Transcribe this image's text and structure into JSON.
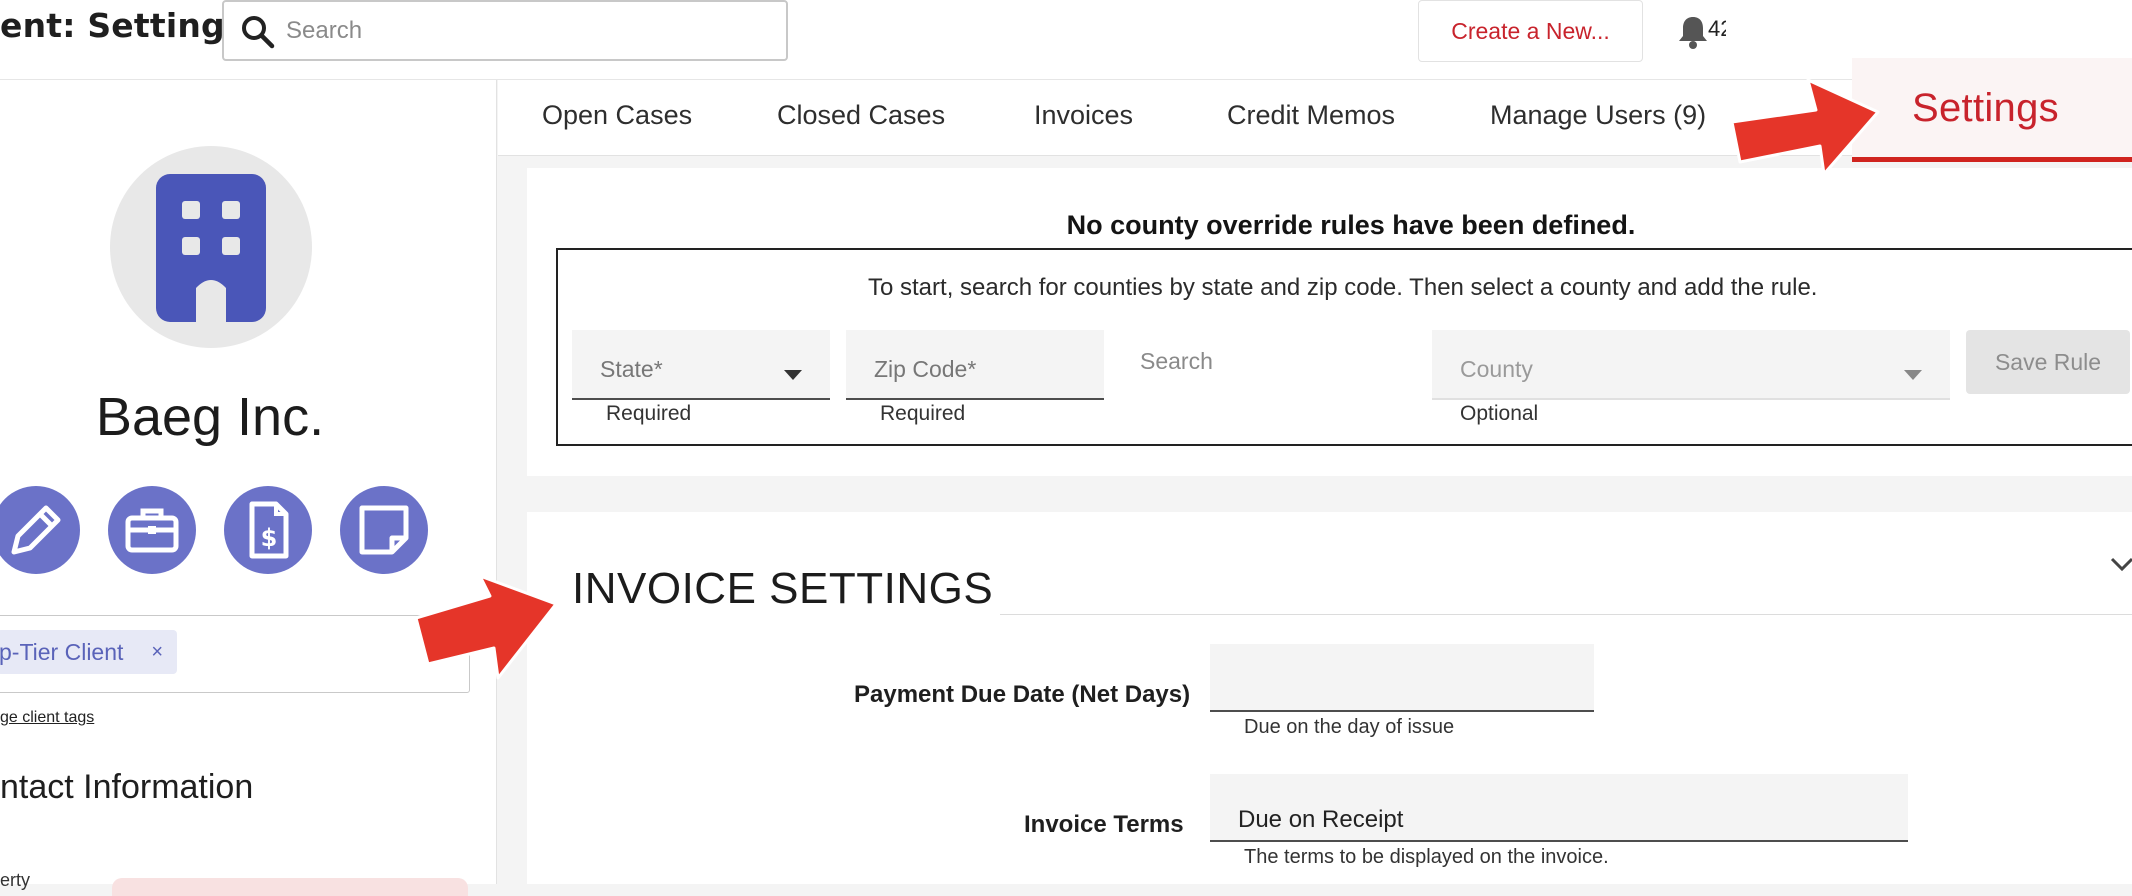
{
  "header": {
    "title": "ent: Settings",
    "search_placeholder": "Search",
    "create_label": "Create a New...",
    "notification_count": "42"
  },
  "client": {
    "name": "Baeg Inc.",
    "tag": "p-Tier Client",
    "tag_remove": "×",
    "manage_tags": "ge client tags",
    "contact_title": "ntact Information",
    "contact_sub": "erty"
  },
  "tabs": {
    "open_cases": "Open Cases",
    "closed_cases": "Closed Cases",
    "invoices": "Invoices",
    "credit_memos": "Credit Memos",
    "manage_users": "Manage Users (9)",
    "settings": "Settings"
  },
  "county": {
    "no_rules": "No county override rules have been defined.",
    "instruction": "To start, search for counties by state and zip code. Then select a county and add the rule.",
    "state_label": "State*",
    "state_help": "Required",
    "zip_label": "Zip Code*",
    "zip_help": "Required",
    "search_label": "Search",
    "county_label": "County",
    "county_help": "Optional",
    "save_label": "Save Rule"
  },
  "invoice": {
    "title": "INVOICE SETTINGS",
    "due_label": "Payment Due Date (Net Days)",
    "due_value": "",
    "due_help": "Due on the day of issue",
    "terms_label": "Invoice Terms",
    "terms_value": "Due on Receipt",
    "terms_help": "The terms to be displayed on the invoice."
  },
  "colors": {
    "accent_red": "#c8232c",
    "action_purple": "#6b72c8",
    "icon_blue": "#4a56b8",
    "arrow_red": "#e53529"
  }
}
